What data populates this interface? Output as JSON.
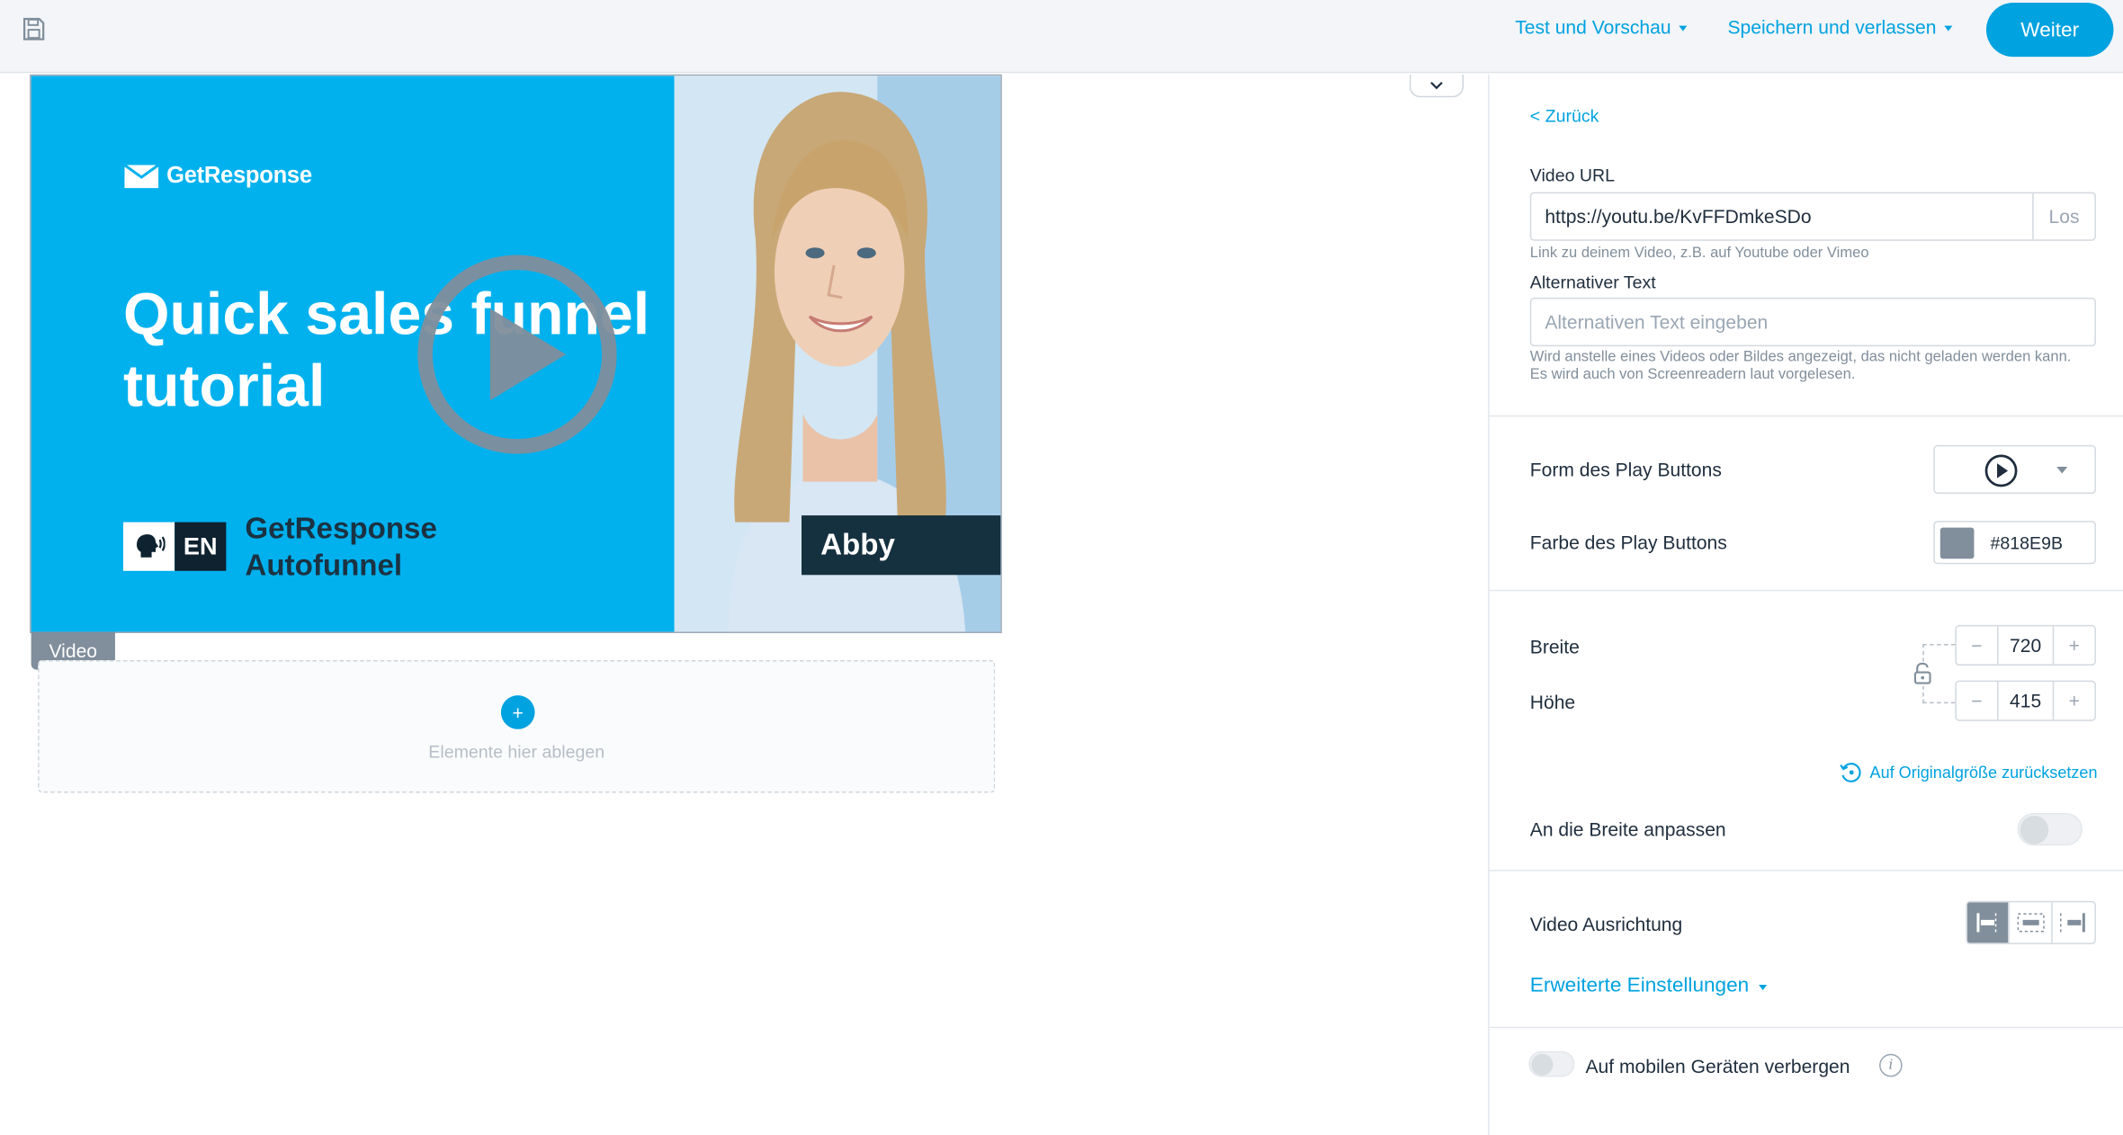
{
  "topbar": {
    "test_preview_label": "Test und Vorschau",
    "save_leave_label": "Speichern und verlassen",
    "next_button_label": "Weiter"
  },
  "video_preview": {
    "logo_text": "GetResponse",
    "headline": "Quick sales funnel tutorial",
    "language_badge": "EN",
    "product_line1": "GetResponse",
    "product_line2": "Autofunnel",
    "presenter_name": "Abby"
  },
  "canvas": {
    "element_tag": "Video",
    "drop_plus": "+",
    "drop_hint": "Elemente hier ablegen"
  },
  "panel": {
    "back_link": "< Zurück",
    "video_url": {
      "label": "Video URL",
      "value": "https://youtu.be/KvFFDmkeSDo",
      "go_button": "Los",
      "hint": "Link zu deinem Video, z.B. auf Youtube oder Vimeo"
    },
    "alt_text": {
      "label": "Alternativer Text",
      "placeholder": "Alternativen Text eingeben",
      "hint": "Wird anstelle eines Videos oder Bildes angezeigt, das nicht geladen werden kann. Es wird auch von Screenreadern laut vorgelesen."
    },
    "play_shape_label": "Form des Play Buttons",
    "play_color_label": "Farbe des Play Buttons",
    "play_color_hex": "#818E9B",
    "width_label": "Breite",
    "width_value": "720",
    "height_label": "Höhe",
    "height_value": "415",
    "minus": "−",
    "plus": "+",
    "reset_link": "Auf Originalgröße zurücksetzen",
    "fit_width_label": "An die Breite anpassen",
    "fit_width_on": false,
    "alignment_label": "Video Ausrichtung",
    "advanced_label": "Erweiterte Einstellungen",
    "hide_mobile_label": "Auf mobilen Geräten verbergen",
    "hide_mobile_on": false,
    "info_glyph": "i"
  },
  "colors": {
    "accent": "#00a2e0",
    "play_button": "#818e9b",
    "video_bg": "#00b1ee"
  }
}
